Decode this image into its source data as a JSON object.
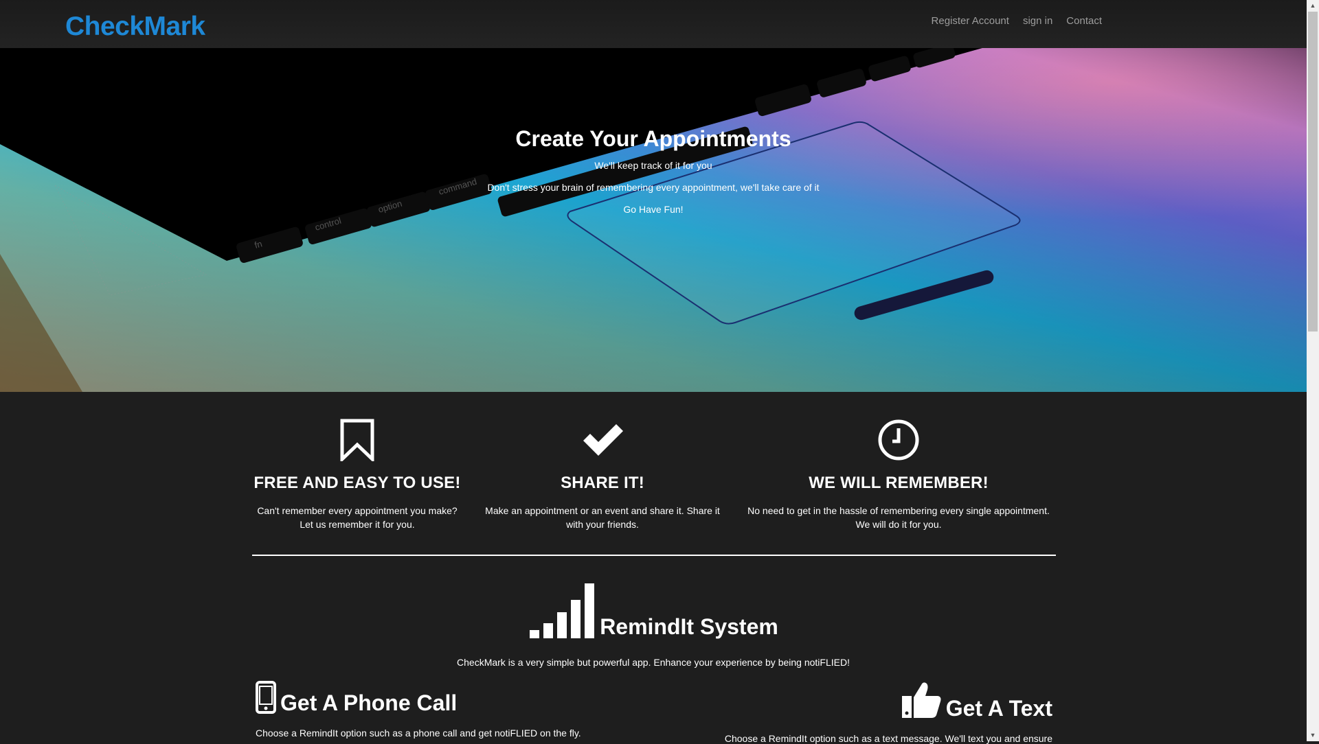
{
  "navbar": {
    "brand": "CheckMark",
    "links": [
      "Register Account",
      "sign in",
      "Contact"
    ]
  },
  "hero": {
    "title": "Create Your Appointments",
    "lines": [
      "We'll keep track of it for you",
      "Don't stress your brain of remembering every appointment, we'll take care of it",
      "Go Have Fun!"
    ],
    "keycaps": [
      "fn",
      "control",
      "option",
      "command"
    ]
  },
  "features": [
    {
      "icon": "bookmark-icon",
      "title": "FREE AND EASY TO USE!",
      "desc_lines": [
        "Can't remember every appointment you make?",
        "Let us remember it for you."
      ]
    },
    {
      "icon": "checkmark-icon",
      "title": "SHARE IT!",
      "desc_lines": [
        "Make an appointment or an event and share it. Share it",
        "with your friends."
      ]
    },
    {
      "icon": "clock-icon",
      "title": "WE WILL REMEMBER!",
      "desc_lines": [
        "No need to get in the hassle of remembering every single appointment.",
        "We will do it for you."
      ]
    }
  ],
  "remindit": {
    "icon": "signal-bars-icon",
    "title": "RemindIt System",
    "desc": "CheckMark is a very simple but powerful app. Enhance your experience by being notiFLIED!"
  },
  "options": [
    {
      "icon": "mobile-phone-icon",
      "title": "Get A Phone Call",
      "desc": "Choose a RemindIt option such as a phone call and get notiFLIED on the fly."
    },
    {
      "icon": "thumbs-up-icon",
      "title": "Get A Text",
      "desc": "Choose a RemindIt option such as a text message. We'll text you and ensure"
    }
  ],
  "colors": {
    "brand": "#1e88d6",
    "background": "#1e1e1e",
    "navbar": "#222222",
    "nav_link": "#9d9d9d"
  }
}
